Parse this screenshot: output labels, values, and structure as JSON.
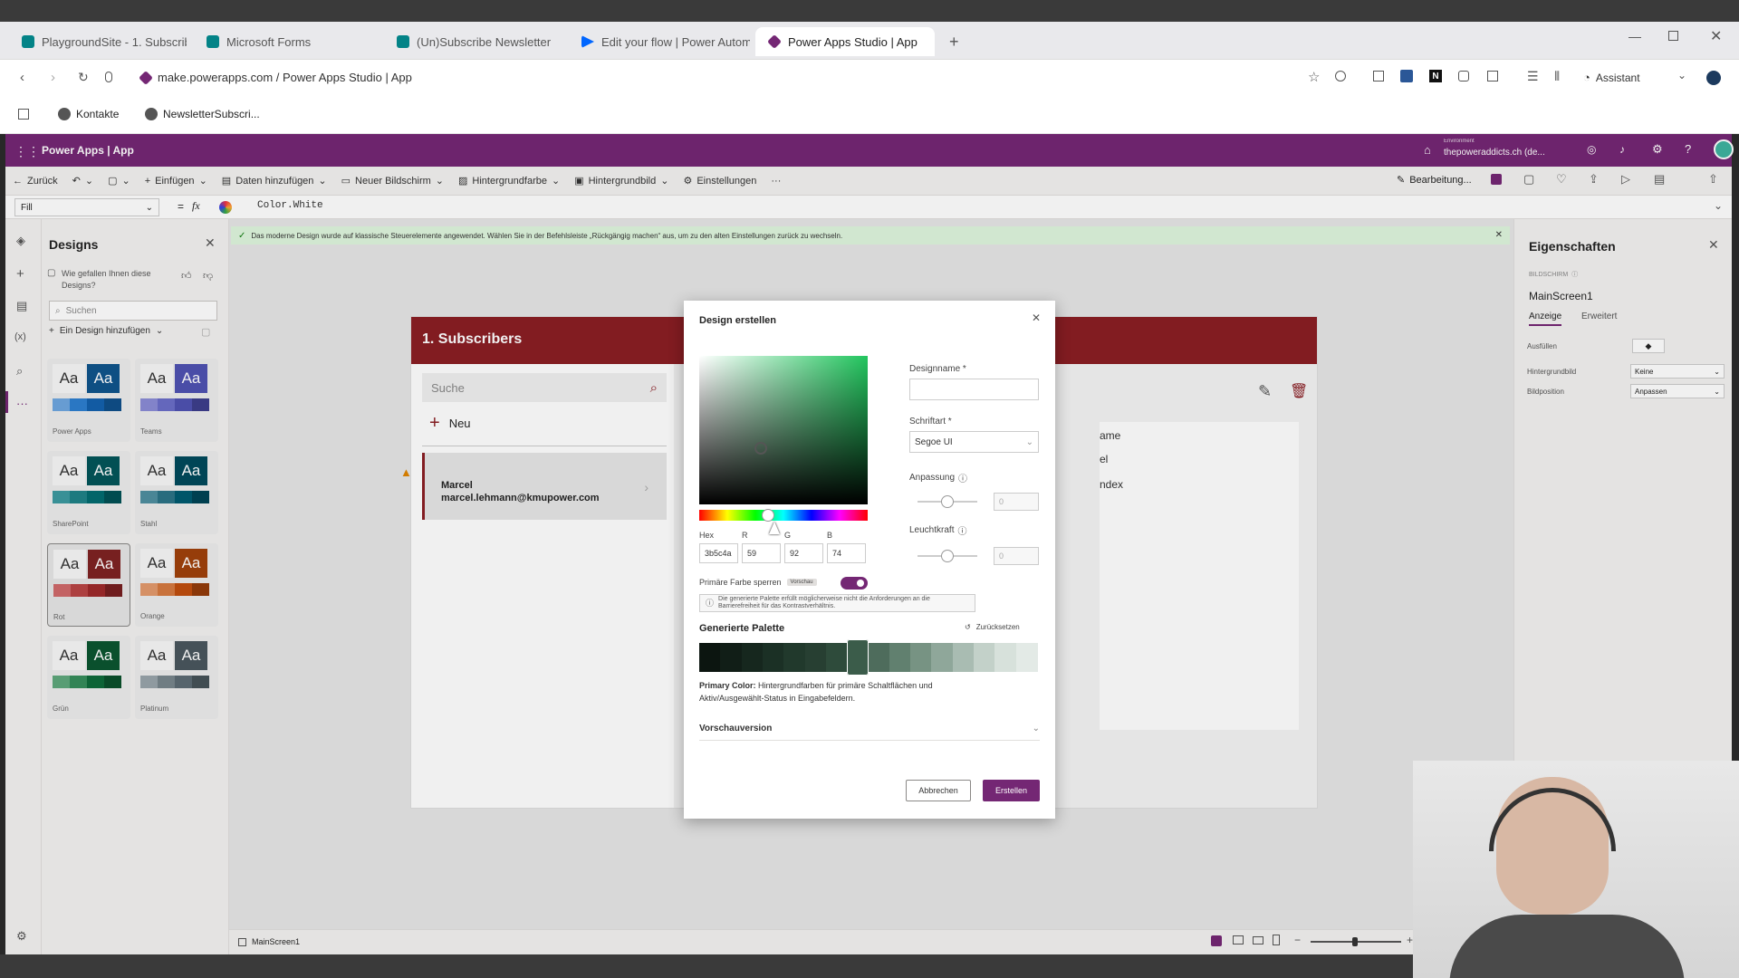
{
  "browser": {
    "tabs": [
      {
        "label": "PlaygroundSite - 1. Subscribe",
        "color": "#038387"
      },
      {
        "label": "Microsoft Forms",
        "color": "#038387"
      },
      {
        "label": "(Un)Subscribe Newsletter",
        "color": "#038387"
      },
      {
        "label": "Edit your flow | Power Autom",
        "color": "#0066ff"
      },
      {
        "label": "Power Apps Studio | App",
        "color": "#742774"
      }
    ],
    "url": "make.powerapps.com / Power Apps Studio | App",
    "assistant_label": "Assistant",
    "bookmarks": [
      {
        "label": "Kontakte"
      },
      {
        "label": "NewsletterSubscri..."
      }
    ]
  },
  "app": {
    "title": "Power Apps | App",
    "environment_label": "Environment",
    "environment_value": "thepoweraddicts.ch (de..."
  },
  "toolbar": {
    "back": "Zurück",
    "insert": "Einfügen",
    "add_data": "Daten hinzufügen",
    "new_screen": "Neuer Bildschirm",
    "bg_color": "Hintergrundfarbe",
    "bg_image": "Hintergrundbild",
    "settings": "Einstellungen",
    "editing": "Bearbeitung..."
  },
  "formula": {
    "property": "Fill",
    "fx": "fx",
    "value": "Color.White"
  },
  "notice": "Das moderne Design wurde auf klassische Steuerelemente angewendet. Wählen Sie in der Befehlsleiste „Rückgängig machen“ aus, um zu den alten Einstellungen zurück zu wechseln.",
  "designs_panel": {
    "title": "Designs",
    "feedback": "Wie gefallen Ihnen diese Designs?",
    "search_placeholder": "Suchen",
    "add_design": "Ein Design hinzufügen",
    "themes": [
      {
        "name": "Power Apps",
        "light": "#0f6cbd",
        "dark": "#0f548c",
        "sw": [
          "#6ea6e0",
          "#2d7fd0",
          "#1461ae",
          "#0f4f8a"
        ]
      },
      {
        "name": "Teams",
        "light": "#5b5fc7",
        "dark": "#4f52b2",
        "sw": [
          "#8b8cd6",
          "#6b6ec8",
          "#4f52b2",
          "#3d3e8c"
        ]
      },
      {
        "name": "SharePoint",
        "light": "#036c70",
        "dark": "#03565a",
        "sw": [
          "#3c9aa0",
          "#1f8287",
          "#036c70",
          "#025155"
        ]
      },
      {
        "name": "Stahl",
        "light": "#005b70",
        "dark": "#004a5c",
        "sw": [
          "#4f8fa0",
          "#2c7386",
          "#005b70",
          "#004556"
        ]
      },
      {
        "name": "Rot",
        "light": "#9e2a2b",
        "dark": "#7f2223",
        "sw": [
          "#d06a6b",
          "#b84445",
          "#9e2a2b",
          "#761f20"
        ]
      },
      {
        "name": "Orange",
        "light": "#c04e0e",
        "dark": "#a0410b",
        "sw": [
          "#e39a6c",
          "#d57a40",
          "#c04e0e",
          "#933b0a"
        ]
      },
      {
        "name": "Grün",
        "light": "#0e6b3a",
        "dark": "#0b5530",
        "sw": [
          "#5ea77c",
          "#368d5b",
          "#0e6b3a",
          "#0a502b"
        ]
      },
      {
        "name": "Platinum",
        "light": "#5c6b73",
        "dark": "#4a575e",
        "sw": [
          "#98a4aa",
          "#77858c",
          "#5c6b73",
          "#465258"
        ]
      }
    ]
  },
  "canvas_app": {
    "header_title": "1. Subscribers",
    "search_placeholder": "Suche",
    "new_label": "Neu",
    "item_name": "Marcel",
    "item_email": "marcel.lehmann@kmupower.com",
    "side_labels": [
      "ame",
      "el",
      "ndex"
    ]
  },
  "modal": {
    "title": "Design erstellen",
    "design_name_label": "Designname *",
    "design_name_value": "",
    "font_label": "Schriftart *",
    "font_value": "Segoe UI",
    "adjust_label": "Anpassung",
    "adjust_value": "0",
    "brightness_label": "Leuchtkraft",
    "brightness_value": "0",
    "hex_label": "Hex",
    "r_label": "R",
    "g_label": "G",
    "b_label": "B",
    "hex_value": "3b5c4a",
    "r_value": "59",
    "g_value": "92",
    "b_value": "74",
    "lock_label": "Primäre Farbe sperren",
    "lock_badge": "Vorschau",
    "lock_on": true,
    "warning": "Die generierte Palette erfüllt möglicherweise nicht die Anforderungen an die Barrierefreiheit für das Kontrastverhältnis.",
    "palette_title": "Generierte Palette",
    "reset_label": "Zurücksetzen",
    "palette_colors": [
      "#0c1510",
      "#111e17",
      "#16271e",
      "#1b3025",
      "#21392c",
      "#273f32",
      "#2e4b3b",
      "#3b5c4a",
      "#4e6c5c",
      "#61806f",
      "#779383",
      "#8fa79a",
      "#a9bcb2",
      "#c3d1c9",
      "#d7e1db",
      "#e3eae6"
    ],
    "palette_selected_index": 7,
    "primary_desc_bold": "Primary Color:",
    "primary_desc": "Hintergrundfarben für primäre Schaltflächen und Aktiv/Ausgewählt-Status in Eingabefeldern.",
    "preview_label": "Vorschauversion",
    "cancel": "Abbrechen",
    "create": "Erstellen",
    "hue_fraction": 0.41
  },
  "properties": {
    "title": "Eigenschaften",
    "kind": "BILDSCHIRM",
    "screen_name": "MainScreen1",
    "tab_display": "Anzeige",
    "tab_advanced": "Erweitert",
    "fill_label": "Ausfüllen",
    "bg_image_label": "Hintergrundbild",
    "bg_image_value": "Keine",
    "image_pos_label": "Bildposition",
    "image_pos_value": "Anpassen"
  },
  "status": {
    "screen": "MainScreen1"
  }
}
